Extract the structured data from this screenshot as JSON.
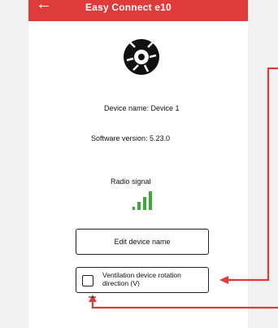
{
  "header": {
    "title": "Easy Connect e10",
    "back_icon": "arrow-left-icon"
  },
  "device": {
    "logo_icon": "vinyl-record-logo-icon",
    "name_text": "Device name: Device 1",
    "software_text": "Software version: 5.23.0"
  },
  "radio": {
    "label": "Radio signal",
    "icon": "signal-bars-icon",
    "color": "#3fa83a"
  },
  "buttons": {
    "edit_label": "Edit device name",
    "ventilation_label": "Ventilation device rotation direction (V)"
  },
  "colors": {
    "accent": "#e03b3b",
    "annotation": "#e03b3b"
  }
}
